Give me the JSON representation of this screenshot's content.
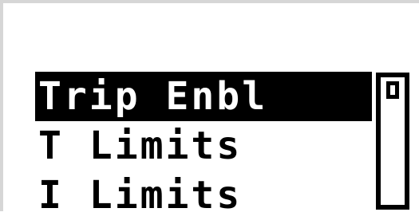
{
  "menu": {
    "items": [
      {
        "label": "Trip Enbl",
        "selected": true
      },
      {
        "label": "T Limits",
        "selected": false
      },
      {
        "label": "I Limits",
        "selected": false
      }
    ]
  },
  "scrollbar": {
    "position_fraction": 0.0
  }
}
